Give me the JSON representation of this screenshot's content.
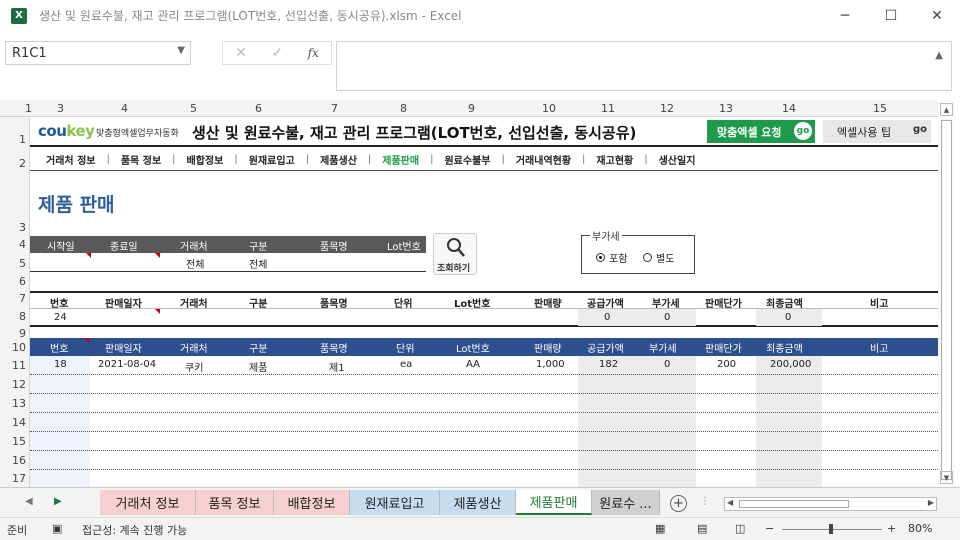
{
  "window": {
    "title": "생산 및 원료수불, 재고 관리 프로그램(LOT번호, 선입선출, 동시공유).xlsm  -  Excel",
    "app_icon": "X"
  },
  "formula_bar": {
    "name_box": "R1C1",
    "cancel": "✕",
    "enter": "✓",
    "fx": "fx",
    "value": ""
  },
  "columns": [
    "1",
    "3",
    "4",
    "5",
    "6",
    "7",
    "8",
    "9",
    "10",
    "11",
    "12",
    "13",
    "14",
    "15"
  ],
  "rows": [
    "1",
    "2",
    "3",
    "4",
    "5",
    "6",
    "7",
    "8",
    "9",
    "10",
    "11",
    "12",
    "13",
    "14",
    "15",
    "16",
    "17"
  ],
  "brand": {
    "logo_main": "cou",
    "logo_accent": "key",
    "logo_sub": "맞춤형엑셀업무자동화",
    "app_title": "생산 및 원료수불, 재고 관리 프로그램(LOT번호, 선입선출, 동시공유)",
    "request_btn": "맞춤엑셀 요청",
    "request_go": "go",
    "tips_btn": "엑셀사용 팁",
    "tips_go": "go"
  },
  "nav": [
    "거래처 정보",
    "품목 정보",
    "배합정보",
    "원재료입고",
    "제품생산",
    "제품판매",
    "원료수불부",
    "거래내역현황",
    "재고현황",
    "생산일지"
  ],
  "nav_active": "제품판매",
  "page_title": "제품 판매",
  "search": {
    "headers": [
      "시작일",
      "종료일",
      "거래처",
      "구분",
      "품목명",
      "Lot번호"
    ],
    "values": {
      "client": "전체",
      "type": "전체"
    },
    "button": "조회하기"
  },
  "vat": {
    "caption": "부가세",
    "options": [
      "포함",
      "별도"
    ],
    "selected": "포함"
  },
  "entry": {
    "headers": [
      "번호",
      "판매일자",
      "거래처",
      "구분",
      "품목명",
      "단위",
      "Lot번호",
      "판매량",
      "공급가액",
      "부가세",
      "판매단가",
      "최종금액",
      "비고"
    ],
    "values": {
      "no": "24",
      "supply": "0",
      "vat": "0",
      "total": "0"
    }
  },
  "list": {
    "headers": [
      "번호",
      "판매일자",
      "거래처",
      "구분",
      "품목명",
      "단위",
      "Lot번호",
      "판매량",
      "공급가액",
      "부가세",
      "판매단가",
      "최종금액",
      "비고"
    ],
    "rows": [
      [
        "18",
        "2021-08-04",
        "쿠키",
        "제품",
        "제1",
        "ea",
        "AA",
        "1,000",
        "182",
        "0",
        "200",
        "200,000",
        ""
      ]
    ]
  },
  "sheet_tabs": [
    "거래처 정보",
    "품목 정보",
    "배합정보",
    "원재료입고",
    "제품생산",
    "제품판매",
    "원료수 ..."
  ],
  "active_tab": "제품판매",
  "status": {
    "ready": "준비",
    "accessibility": "접근성: 계속 진행 가능",
    "zoom": "80%"
  },
  "colors": {
    "accent_green": "#1f9a4b",
    "title_blue": "#2e5e9e",
    "list_header": "#2e4f8e",
    "search_header": "#595959"
  }
}
